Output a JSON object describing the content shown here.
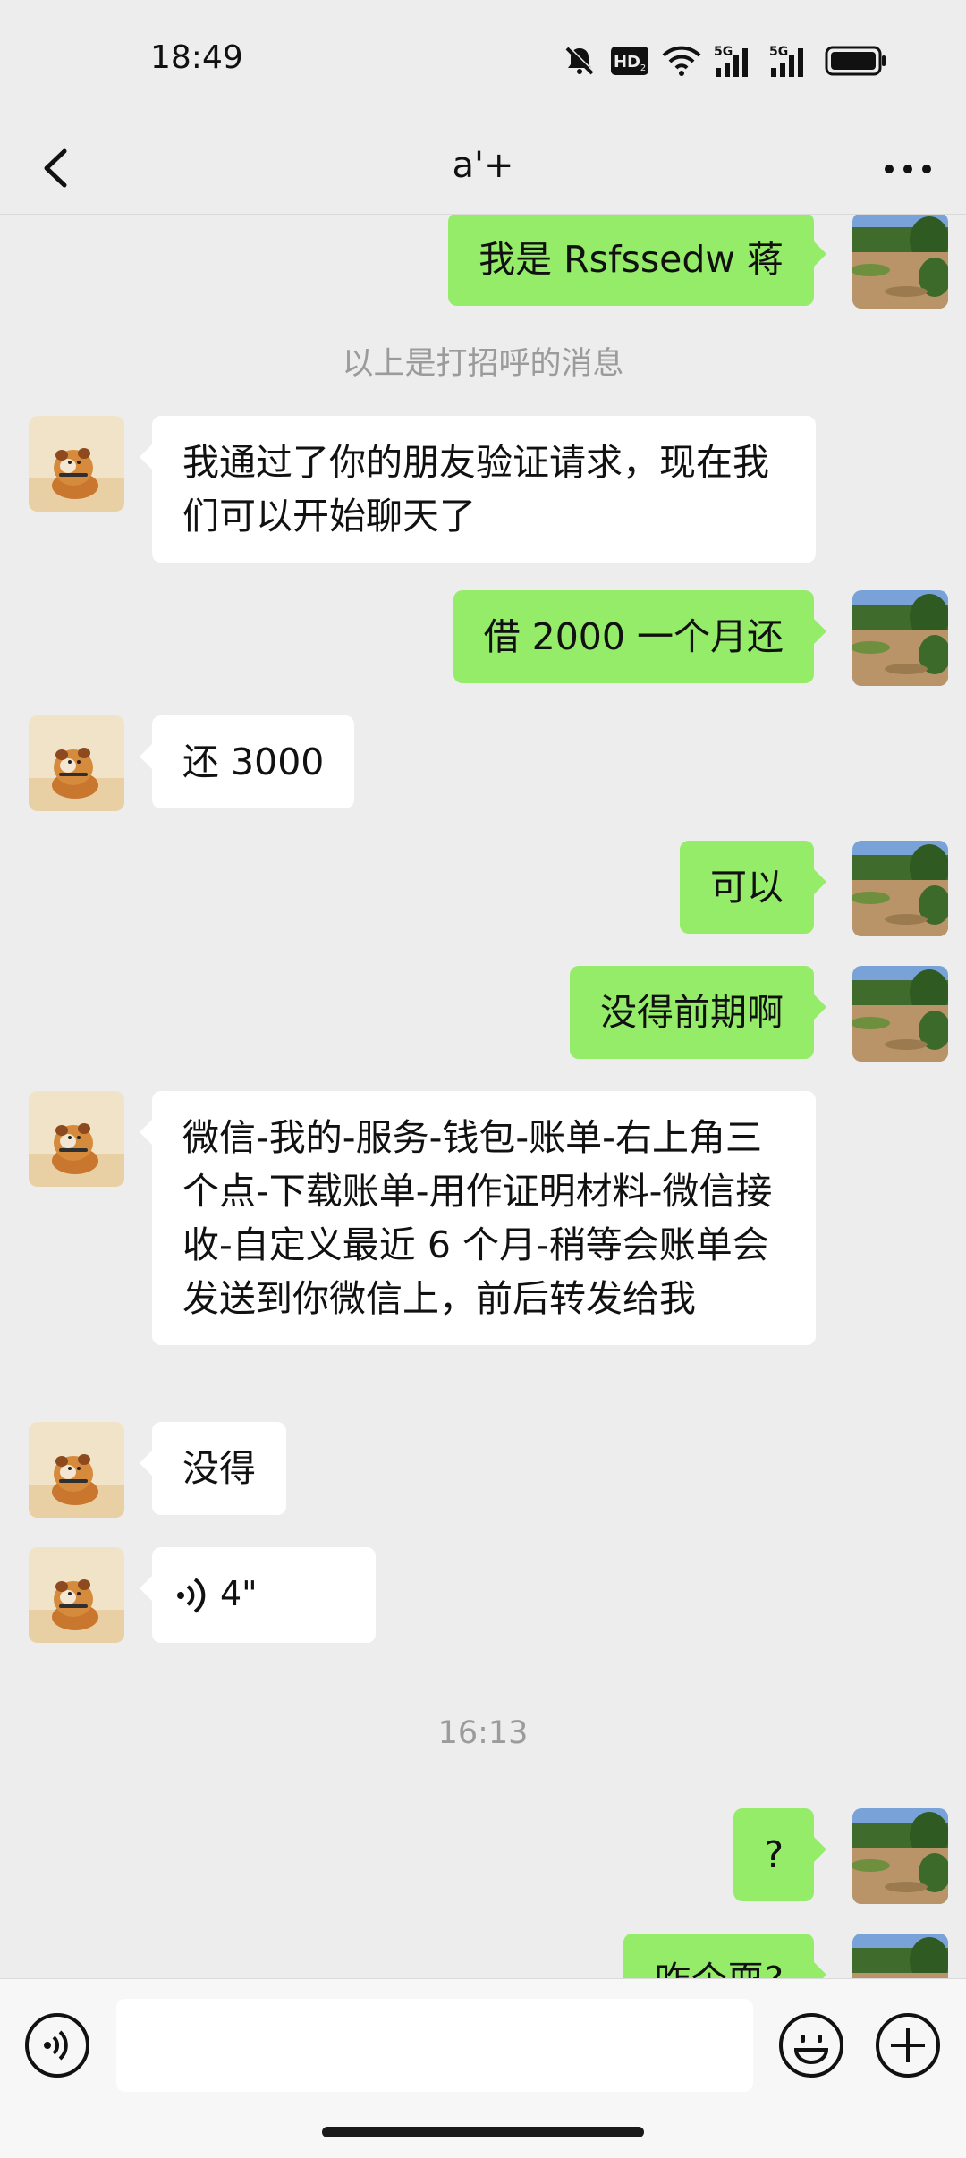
{
  "status_bar": {
    "time": "18:49",
    "icons": [
      "mute-bell-icon",
      "hd-icon",
      "wifi-icon",
      "5g-signal-icon",
      "5g-signal-icon",
      "battery-icon"
    ],
    "hd_label": "HD",
    "net_label": "5G"
  },
  "header": {
    "title": "a'+",
    "back_icon": "chevron-left-icon",
    "more_icon": "more-dots-icon"
  },
  "messages": [
    {
      "side": "right",
      "text": "我是 Rsfssedw 蒋"
    },
    {
      "side": "system",
      "text": "以上是打招呼的消息"
    },
    {
      "side": "left",
      "text": "我通过了你的朋友验证请求，现在我们可以开始聊天了"
    },
    {
      "side": "right",
      "text": "借 2000 一个月还"
    },
    {
      "side": "left",
      "text": "还 3000"
    },
    {
      "side": "right",
      "text": "可以"
    },
    {
      "side": "right",
      "text": "没得前期啊"
    },
    {
      "side": "left",
      "text": "微信-我的-服务-钱包-账单-右上角三个点-下载账单-用作证明材料-微信接收-自定义最近 6 个月-稍等会账单会发送到你微信上，前后转发给我"
    },
    {
      "side": "left",
      "text": "没得"
    },
    {
      "side": "left",
      "type": "voice",
      "text": "4\""
    },
    {
      "side": "system",
      "text": "16:13"
    },
    {
      "side": "right",
      "text": "?"
    },
    {
      "side": "right",
      "text": "咋个耍?"
    }
  ],
  "input_bar": {
    "voice_icon": "voice-input-icon",
    "emoji_icon": "emoji-icon",
    "plus_icon": "plus-icon",
    "input_value": ""
  },
  "colors": {
    "background": "#EDEDED",
    "sent_bubble": "#95EC69",
    "received_bubble": "#FFFFFF",
    "system_text": "#9B9B9B"
  }
}
